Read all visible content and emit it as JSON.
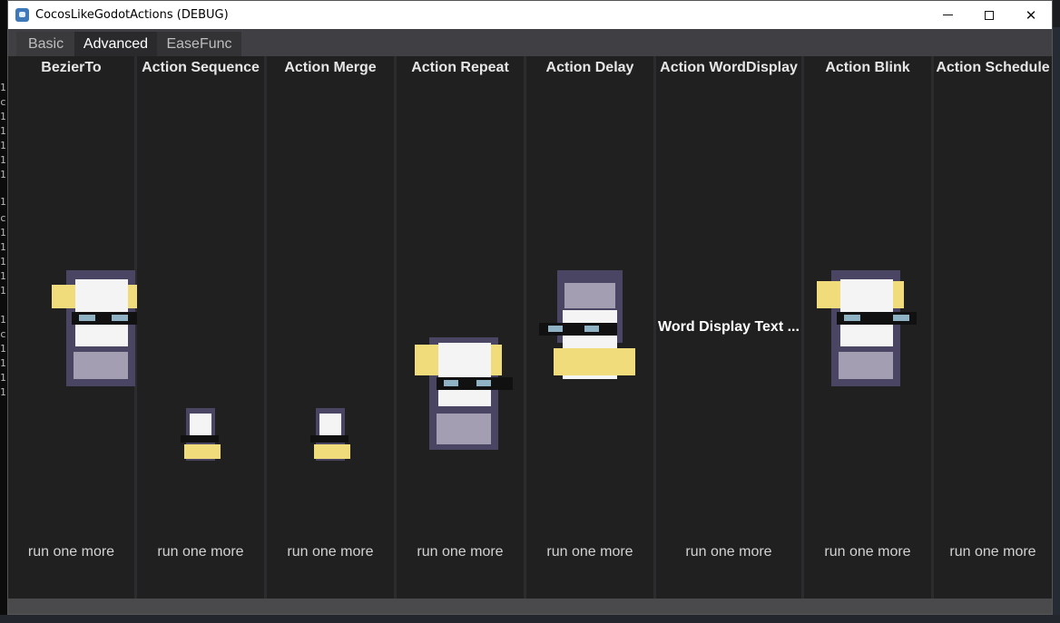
{
  "window": {
    "title": "CocosLikeGodotActions (DEBUG)"
  },
  "tabs": [
    {
      "label": "Basic",
      "active": false
    },
    {
      "label": "Advanced",
      "active": true
    },
    {
      "label": "EaseFunc",
      "active": false
    }
  ],
  "columns": [
    {
      "title": "BezierTo",
      "button": "run one more"
    },
    {
      "title": "Action Sequence",
      "button": "run one more"
    },
    {
      "title": "Action Merge",
      "button": "run one more"
    },
    {
      "title": "Action Repeat",
      "button": "run one more"
    },
    {
      "title": "Action Delay",
      "button": "run one more"
    },
    {
      "title": "Action WordDisplay",
      "button": "run one more",
      "text": "Word Display Text ..."
    },
    {
      "title": "Action Blink",
      "button": "run one more"
    },
    {
      "title": "Action Schedule",
      "button": "run one more"
    }
  ],
  "colors": {
    "panel": "#202020",
    "tab_active": "#2a2a2d",
    "title_bar": "#ffffff"
  },
  "icons": {
    "app": "godot-app-icon",
    "minimize": "minimize-icon",
    "maximize": "maximize-icon",
    "close": "close-icon"
  }
}
